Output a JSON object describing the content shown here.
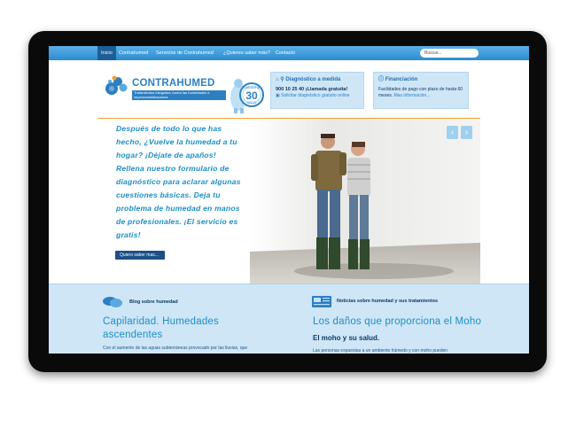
{
  "nav": {
    "items": [
      {
        "label": "Inicio",
        "active": true
      },
      {
        "label": "Contrahumed",
        "active": false
      },
      {
        "label": "Servicios de Contrahumed",
        "active": false
      },
      {
        "label": "¿Quieres saber más?",
        "active": false
      },
      {
        "label": "Contacto",
        "active": false
      }
    ],
    "search_placeholder": "Buscar..."
  },
  "brand": {
    "name": "CONTRAHUMED",
    "tagline": "Tratamientos integrales contra las humedades e impermeabilizaciones",
    "badge_line1": "GARANTÍA",
    "badge_number": "30",
    "badge_line2": "AÑOS"
  },
  "promo_diagnostico": {
    "title": "Diagnóstico a medida",
    "phone": "900 10 25 40 ¡Llamada gratuita!",
    "link": "Solicitar diagnóstico gratuito online"
  },
  "promo_financiacion": {
    "title": "Financiación",
    "text": "Facilidades de pago con plazo de hasta 60 meses.",
    "more": "Mas información..."
  },
  "hero": {
    "text": "Después de todo lo que has hecho, ¿Vuelve la humedad a tu hogar? ¡Déjate de apaños! Rellena nuestro formulario de diagnóstico para aclarar algunas cuestiones básicas. Deja tu problema de humedad en manos de profesionales. ¡El servicio es gratis!",
    "button": "Quiero saber mas...",
    "prev": "‹",
    "next": "›"
  },
  "blog": {
    "label": "Blog sobre humedad",
    "title": "Capilaridad. Humedades ascendentes",
    "body": "Con el aumento de las aguas subterráneas provocado por las lluvias, que"
  },
  "news": {
    "label": "Noticias sobre humedad y sus tratamientos",
    "title": "Los daños que proporciona el Moho",
    "subtitle": "El moho y su salud.",
    "body": "Las personas expuestas a un ambiente húmedo y con moho pueden"
  },
  "colors": {
    "accent": "#2d8ccf",
    "nav_active": "#1c5f98",
    "highlight": "#f0a030",
    "panel": "#cfe6f7"
  }
}
